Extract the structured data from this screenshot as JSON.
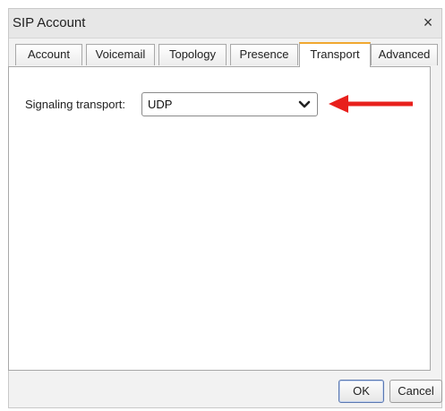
{
  "window": {
    "title": "SIP Account",
    "close_glyph": "×"
  },
  "tabs": [
    {
      "label": "Account"
    },
    {
      "label": "Voicemail"
    },
    {
      "label": "Topology"
    },
    {
      "label": "Presence"
    },
    {
      "label": "Transport"
    },
    {
      "label": "Advanced"
    }
  ],
  "active_tab": "Transport",
  "transport": {
    "label": "Signaling transport:",
    "value": "UDP"
  },
  "buttons": {
    "ok": "OK",
    "cancel": "Cancel"
  },
  "colors": {
    "annotation_arrow": "#e8201c",
    "active_tab_accent": "#f0a830"
  },
  "icons": {
    "dropdown": "chevron-down-icon",
    "close": "close-icon",
    "annotation": "red-arrow-icon"
  }
}
